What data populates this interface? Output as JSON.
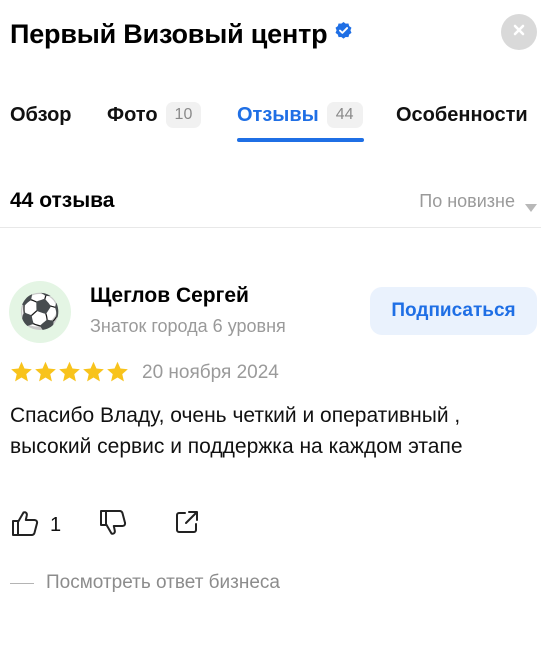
{
  "header": {
    "title": "Первый Визовый центр",
    "verified_icon": "verified-check-icon",
    "close_icon": "close-icon"
  },
  "tabs": [
    {
      "label": "Обзор"
    },
    {
      "label": "Фото",
      "count": "10"
    },
    {
      "label": "Отзывы",
      "count": "44",
      "active": true
    },
    {
      "label": "Особенности"
    }
  ],
  "reviews_header": {
    "count_label": "44 отзыва",
    "sort_label": "По новизне"
  },
  "review": {
    "avatar_icon": "soccer-ball-icon",
    "avatar_glyph": "⚽",
    "author": "Щеглов Сергей",
    "level": "Знаток города 6 уровня",
    "subscribe_label": "Подписаться",
    "rating": 5,
    "date": "20 ноября 2024",
    "text": "Спасибо Владу, очень четкий и оперативный , высокий сервис и поддержка на каждом этапе",
    "likes": "1",
    "business_answer_label": "Посмотреть ответ бизнеса"
  },
  "colors": {
    "accent": "#1f6fe5",
    "star": "#f8c31c",
    "muted": "#9a9a9a"
  }
}
